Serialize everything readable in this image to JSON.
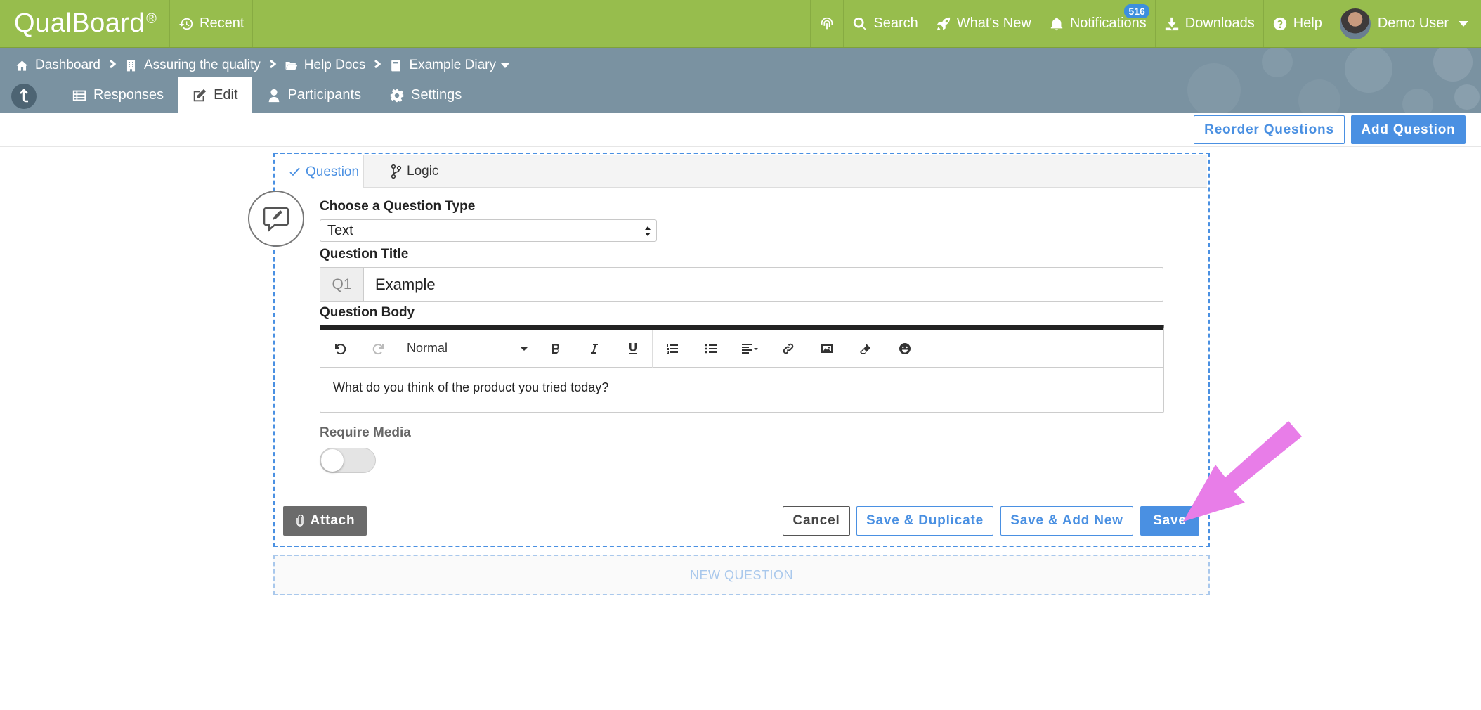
{
  "topbar": {
    "logo": "QualBoard",
    "logo_mark": "®",
    "recent": "Recent",
    "search": "Search",
    "whats_new": "What's New",
    "notifications": "Notifications",
    "notifications_badge": "516",
    "downloads": "Downloads",
    "help": "Help",
    "user": "Demo User"
  },
  "breadcrumb": [
    {
      "label": "Dashboard",
      "icon": "home-icon"
    },
    {
      "label": "Assuring the quality",
      "icon": "building-icon"
    },
    {
      "label": "Help Docs",
      "icon": "folder-open-icon"
    },
    {
      "label": "Example Diary",
      "icon": "book-icon"
    }
  ],
  "tabs": [
    {
      "label": "Responses",
      "icon": "list-icon"
    },
    {
      "label": "Edit",
      "icon": "edit-icon",
      "active": true
    },
    {
      "label": "Participants",
      "icon": "user-icon"
    },
    {
      "label": "Settings",
      "icon": "gear-icon"
    }
  ],
  "actions": {
    "reorder": "Reorder Questions",
    "add": "Add Question"
  },
  "question": {
    "tab_question": "Question",
    "tab_logic": "Logic",
    "type_label": "Choose a Question Type",
    "type_value": "Text",
    "title_label": "Question Title",
    "title_prefix": "Q1",
    "title_value": "Example",
    "body_label": "Question Body",
    "format_value": "Normal",
    "body_text": "What do you think of the product you tried today?",
    "require_media_label": "Require Media",
    "require_media_on": false,
    "attach": "Attach",
    "cancel": "Cancel",
    "save_duplicate": "Save & Duplicate",
    "save_add_new": "Save & Add New",
    "save": "Save"
  },
  "new_question": "NEW QUESTION",
  "colors": {
    "topbar": "#97bd4d",
    "subheader": "#7a92a1",
    "accent": "#4a90e2",
    "annotation_arrow": "#e87de8"
  }
}
